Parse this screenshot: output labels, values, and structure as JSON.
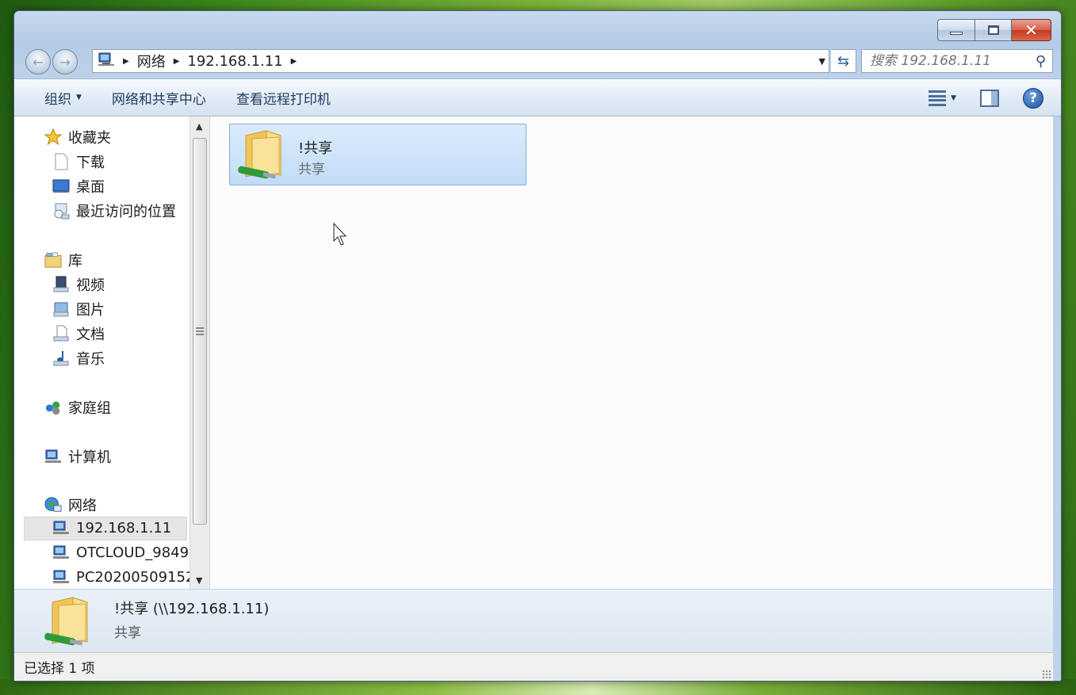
{
  "window": {
    "caption": {
      "minimize": "min",
      "maximize": "max",
      "close": "✕"
    }
  },
  "address_bar": {
    "segments": [
      "网络",
      "192.168.1.11"
    ],
    "search_placeholder": "搜索 192.168.1.11"
  },
  "toolbar": {
    "organize": "组织",
    "network_center": "网络和共享中心",
    "remote_printers": "查看远程打印机",
    "help": "?"
  },
  "nav": {
    "favorites": "收藏夹",
    "downloads": "下载",
    "desktop": "桌面",
    "recent": "最近访问的位置",
    "libraries": "库",
    "videos": "视频",
    "pictures": "图片",
    "documents": "文档",
    "music": "音乐",
    "homegroup": "家庭组",
    "computer": "计算机",
    "network": "网络",
    "network_items": [
      "192.168.1.11",
      "OTCLOUD_9849",
      "PC20200509152"
    ]
  },
  "files": [
    {
      "name": "!共享",
      "type": "共享"
    }
  ],
  "details": {
    "name": "!共享 (\\\\192.168.1.11)",
    "type": "共享"
  },
  "status": {
    "text": "已选择 1 项"
  },
  "colors": {
    "selection": "#cce3fa",
    "title_bar": "#bed2ea",
    "close_button": "#c33a1f"
  }
}
